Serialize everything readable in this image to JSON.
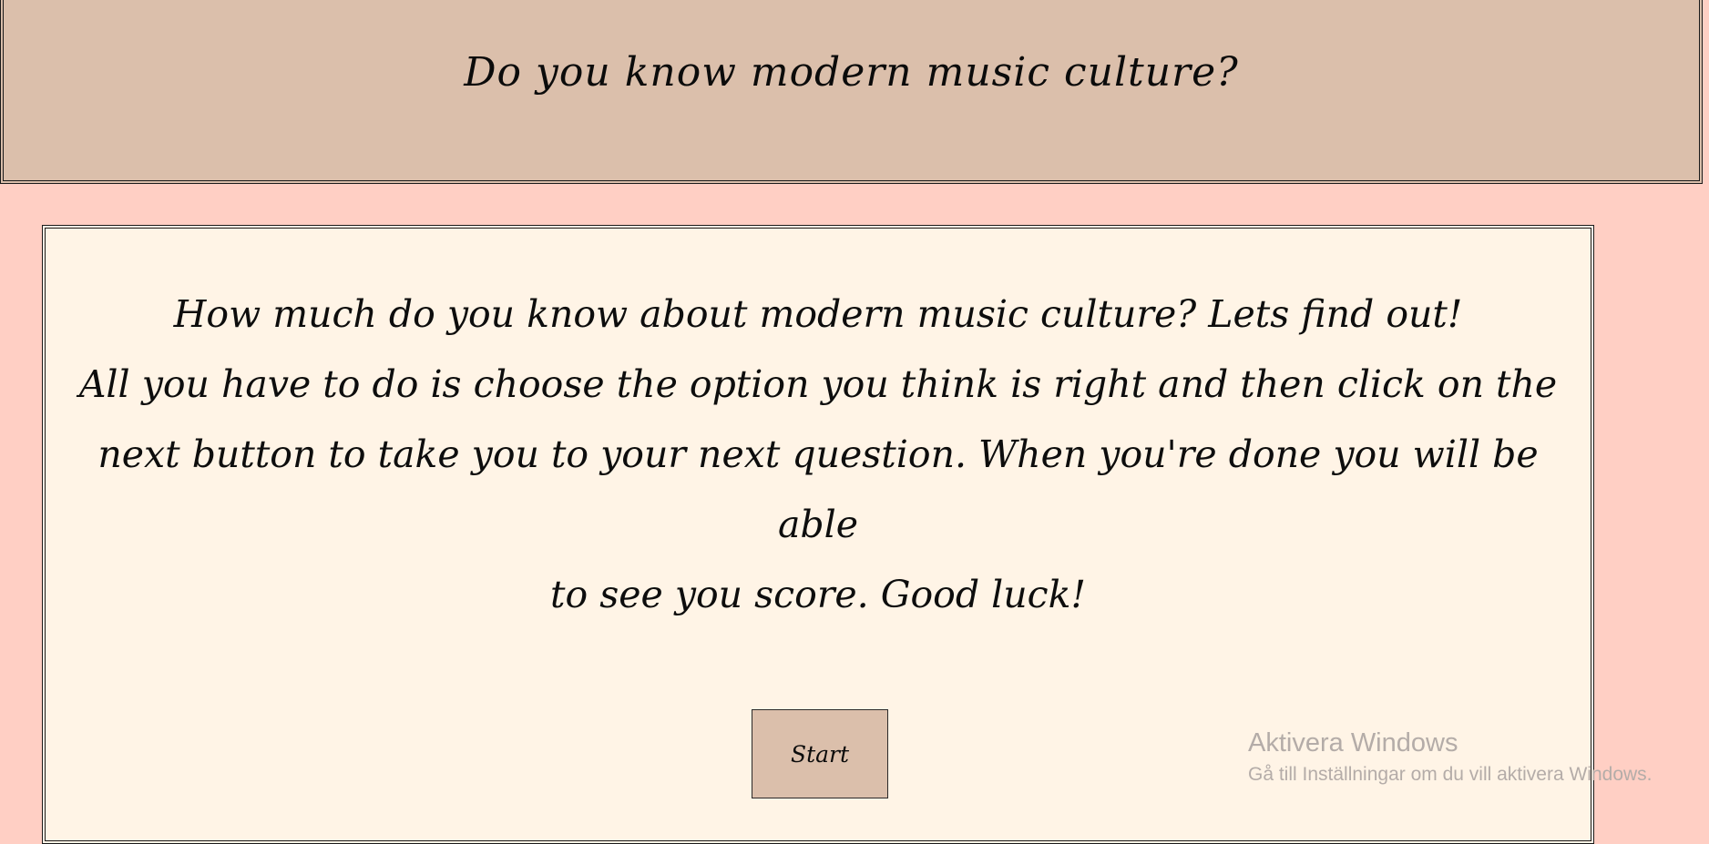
{
  "header": {
    "title": "Do you know modern music culture?"
  },
  "intro": {
    "lines": [
      "How much do you know about modern music culture? Lets find out!",
      "All you have to do is choose the option you think is right and then click on the",
      "next button to take you to your next question. When you're done you will be able",
      "to see you score. Good luck!"
    ]
  },
  "actions": {
    "start_label": "Start"
  },
  "watermark": {
    "title": "Aktivera Windows",
    "subtitle": "Gå till Inställningar om du vill aktivera Windows."
  },
  "colors": {
    "page_background": "#ffcfc4",
    "header_background": "#dbbfab",
    "card_background": "#fff4e6",
    "button_background": "#dbbfab"
  }
}
